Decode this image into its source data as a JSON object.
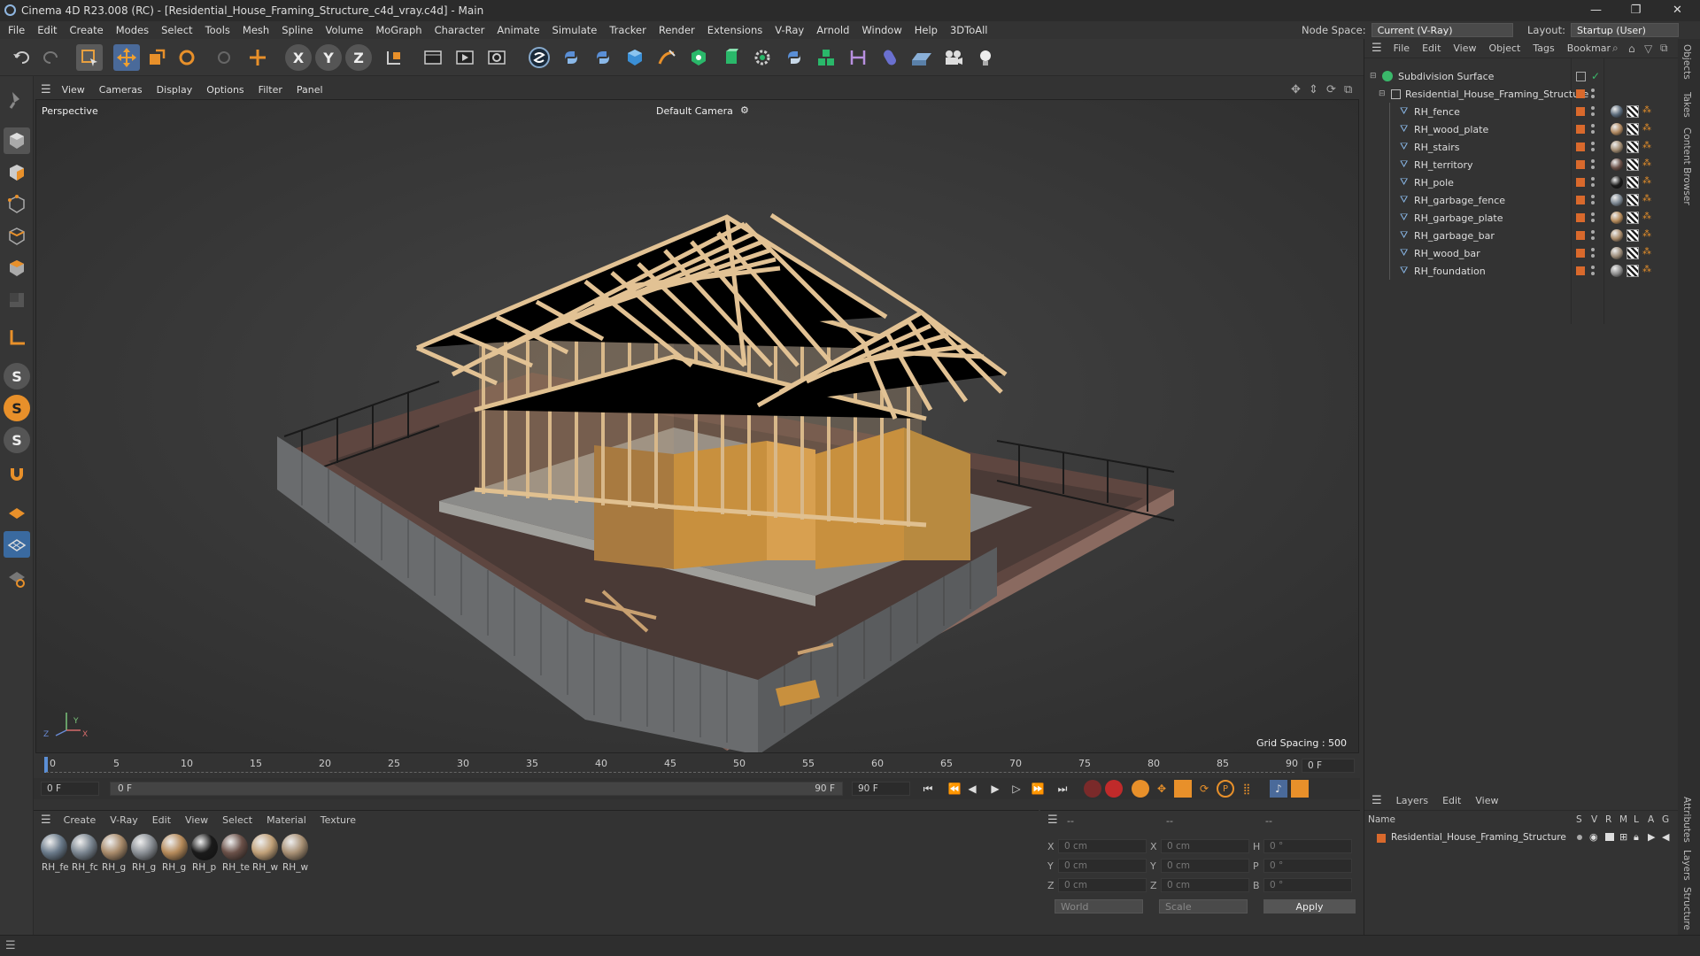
{
  "app": {
    "title": "Cinema 4D R23.008 (RC) - [Residential_House_Framing_Structure_c4d_vray.c4d] - Main",
    "minimize": "—",
    "maximize": "❐",
    "close": "✕"
  },
  "menu": [
    "File",
    "Edit",
    "Create",
    "Modes",
    "Select",
    "Tools",
    "Mesh",
    "Spline",
    "Volume",
    "MoGraph",
    "Character",
    "Animate",
    "Simulate",
    "Tracker",
    "Render",
    "Extensions",
    "V-Ray",
    "Arnold",
    "Window",
    "Help",
    "3DToAll"
  ],
  "nodespace": {
    "label": "Node Space:",
    "value": "Current (V-Ray)"
  },
  "layout": {
    "label": "Layout:",
    "value": "Startup (User)"
  },
  "viewport": {
    "menu": [
      "View",
      "Cameras",
      "Display",
      "Options",
      "Filter",
      "Panel"
    ],
    "projection": "Perspective",
    "camera": "Default Camera",
    "camera_icon": "⚙",
    "grid_spacing": "Grid Spacing : 500 cm",
    "axis_labels": {
      "x": "X",
      "y": "Y",
      "z": "Z"
    }
  },
  "timeline": {
    "ticks": [
      "0",
      "5",
      "10",
      "15",
      "20",
      "25",
      "30",
      "35",
      "40",
      "45",
      "50",
      "55",
      "60",
      "65",
      "70",
      "75",
      "80",
      "85",
      "90"
    ],
    "current_frame": "0 F",
    "start_field": "0 F",
    "range_start": "0 F",
    "range_end": "90 F",
    "end_field": "90 F"
  },
  "material_panel": {
    "menu": [
      "Create",
      "V-Ray",
      "Edit",
      "View",
      "Select",
      "Material",
      "Texture"
    ],
    "materials": [
      {
        "label": "RH_fe",
        "color": "#6a7a8a"
      },
      {
        "label": "RH_fc",
        "color": "#7a8590"
      },
      {
        "label": "RH_g",
        "color": "#a88a6a"
      },
      {
        "label": "RH_g",
        "color": "#8a8f95"
      },
      {
        "label": "RH_g",
        "color": "#b58a5a"
      },
      {
        "label": "RH_p",
        "color": "#1a1a1a"
      },
      {
        "label": "RH_te",
        "color": "#6a5048"
      },
      {
        "label": "RH_w",
        "color": "#c0a078"
      },
      {
        "label": "RH_w",
        "color": "#a89074"
      }
    ]
  },
  "coords": {
    "header_left": "--",
    "header_mid": "--",
    "header_right": "--",
    "rows": [
      {
        "a": "X",
        "av": "0 cm",
        "b": "X",
        "bv": "0 cm",
        "c": "H",
        "cv": "0 °"
      },
      {
        "a": "Y",
        "av": "0 cm",
        "b": "Y",
        "bv": "0 cm",
        "c": "P",
        "cv": "0 °"
      },
      {
        "a": "Z",
        "av": "0 cm",
        "b": "Z",
        "bv": "0 cm",
        "c": "B",
        "cv": "0 °"
      }
    ],
    "space": "World",
    "mode": "Scale",
    "apply": "Apply"
  },
  "object_manager": {
    "menu": [
      "File",
      "Edit",
      "View",
      "Object",
      "Tags",
      "Bookmar"
    ],
    "root": "Subdivision Surface",
    "group": "Residential_House_Framing_Structure",
    "objects": [
      {
        "name": "RH_fence",
        "tag": "#5a6a7a"
      },
      {
        "name": "RH_wood_plate",
        "tag": "#b08860"
      },
      {
        "name": "RH_stairs",
        "tag": "#a08a70"
      },
      {
        "name": "RH_territory",
        "tag": "#6a5048"
      },
      {
        "name": "RH_pole",
        "tag": "#1a1a1a"
      },
      {
        "name": "RH_garbage_fence",
        "tag": "#7a8590"
      },
      {
        "name": "RH_garbage_plate",
        "tag": "#b58a5a"
      },
      {
        "name": "RH_garbage_bar",
        "tag": "#a88a6a"
      },
      {
        "name": "RH_wood_bar",
        "tag": "#9a8a78"
      },
      {
        "name": "RH_foundation",
        "tag": "#8a8a8a"
      }
    ]
  },
  "layers": {
    "menu": [
      "Layers",
      "Edit",
      "View"
    ],
    "columns": [
      "Name",
      "S",
      "V",
      "R",
      "M",
      "L",
      "A",
      "G"
    ],
    "items": [
      {
        "name": "Residential_House_Framing_Structure"
      }
    ]
  },
  "side_tabs": {
    "top": [
      "Objects",
      "Takes",
      "Content Browser"
    ],
    "bottom": [
      "Attributes",
      "Layers",
      "Structure"
    ]
  },
  "colors": {
    "accent": "#4a7fc0",
    "orange": "#d9692c",
    "playhead": "#5b8fd6"
  }
}
